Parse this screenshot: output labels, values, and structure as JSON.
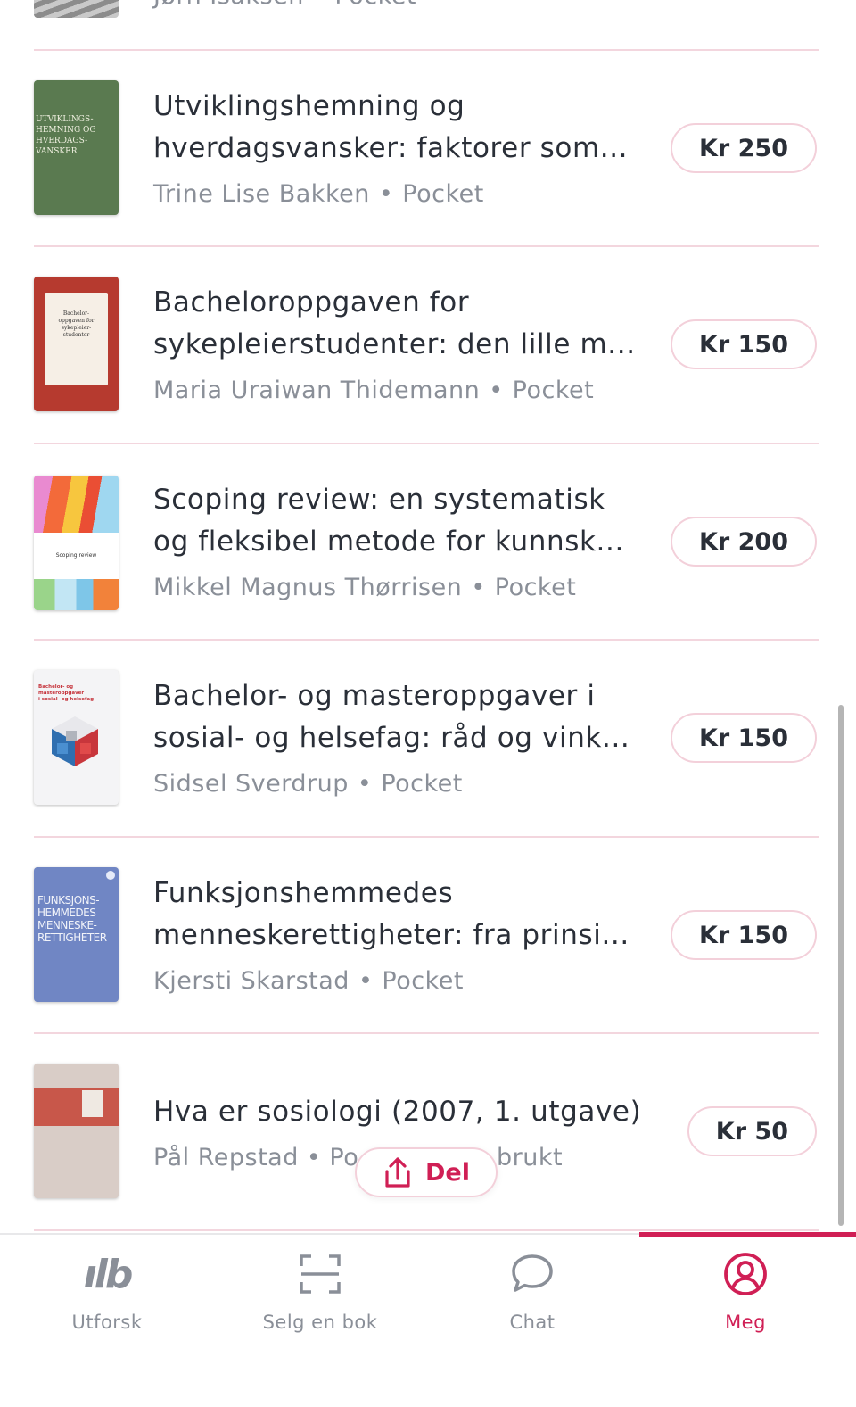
{
  "partial_item": {
    "meta": "Jørn Isaksen • Pocket"
  },
  "books": [
    {
      "title_line1": "Utviklingshemning og",
      "title_line2": "hverdagsvansker: faktorer som...",
      "author": "Trine Lise Bakken",
      "format": "Pocket",
      "price": "Kr 250"
    },
    {
      "title_line1": "Bacheloroppgaven for",
      "title_line2": "sykepleierstudenter: den lille m...",
      "author": "Maria Uraiwan Thidemann",
      "format": "Pocket",
      "price": "Kr 150"
    },
    {
      "title_line1": "Scoping review: en systematisk",
      "title_line2": "og fleksibel metode for kunnsk...",
      "author": "Mikkel Magnus Thørrisen",
      "format": "Pocket",
      "price": "Kr 200"
    },
    {
      "title_line1": "Bachelor- og masteroppgaver i",
      "title_line2": "sosial- og helsefag: råd og vink...",
      "author": "Sidsel Sverdrup",
      "format": "Pocket",
      "price": "Kr 150"
    },
    {
      "title_line1": "Funksjonshemmedes",
      "title_line2": "menneskerettigheter: fra prinsi...",
      "author": "Kjersti Skarstad",
      "format": "Pocket",
      "price": "Kr 150"
    },
    {
      "title_line1": "Hva er sosiologi (2007, 1. utgave)",
      "author": "Pål Repstad",
      "meta_left": "Pål Repstad • Po",
      "meta_right": "brukt",
      "price": "Kr 50"
    }
  ],
  "covers": {
    "c1": "UTVIKLINGS-\nHEMNING OG\nHVERDAGS-\nVANSKER",
    "c2": "Bachelor-\noppgaven for\nsykepleier-\nstudenter",
    "c3": "Scoping review",
    "c4": "Bachelor- og masteroppgaver\ni sosial- og helsefag",
    "c5": "FUNKSJONS-\nHEMMEDES\nMENNESKE-\nRETTIGHETER"
  },
  "share_button": {
    "label": "Del",
    "icon": "share-icon"
  },
  "nav": {
    "tabs": [
      {
        "label": "Utforsk",
        "icon": "logo-icon",
        "active": false
      },
      {
        "label": "Selg en bok",
        "icon": "scan-icon",
        "active": false
      },
      {
        "label": "Chat",
        "icon": "chat-bubble-icon",
        "active": false
      },
      {
        "label": "Meg",
        "icon": "profile-icon",
        "active": true
      }
    ]
  },
  "colors": {
    "accent": "#d01f55",
    "divider": "#f3d6de",
    "muted_text": "#8a8f98",
    "text": "#2a2f38"
  }
}
